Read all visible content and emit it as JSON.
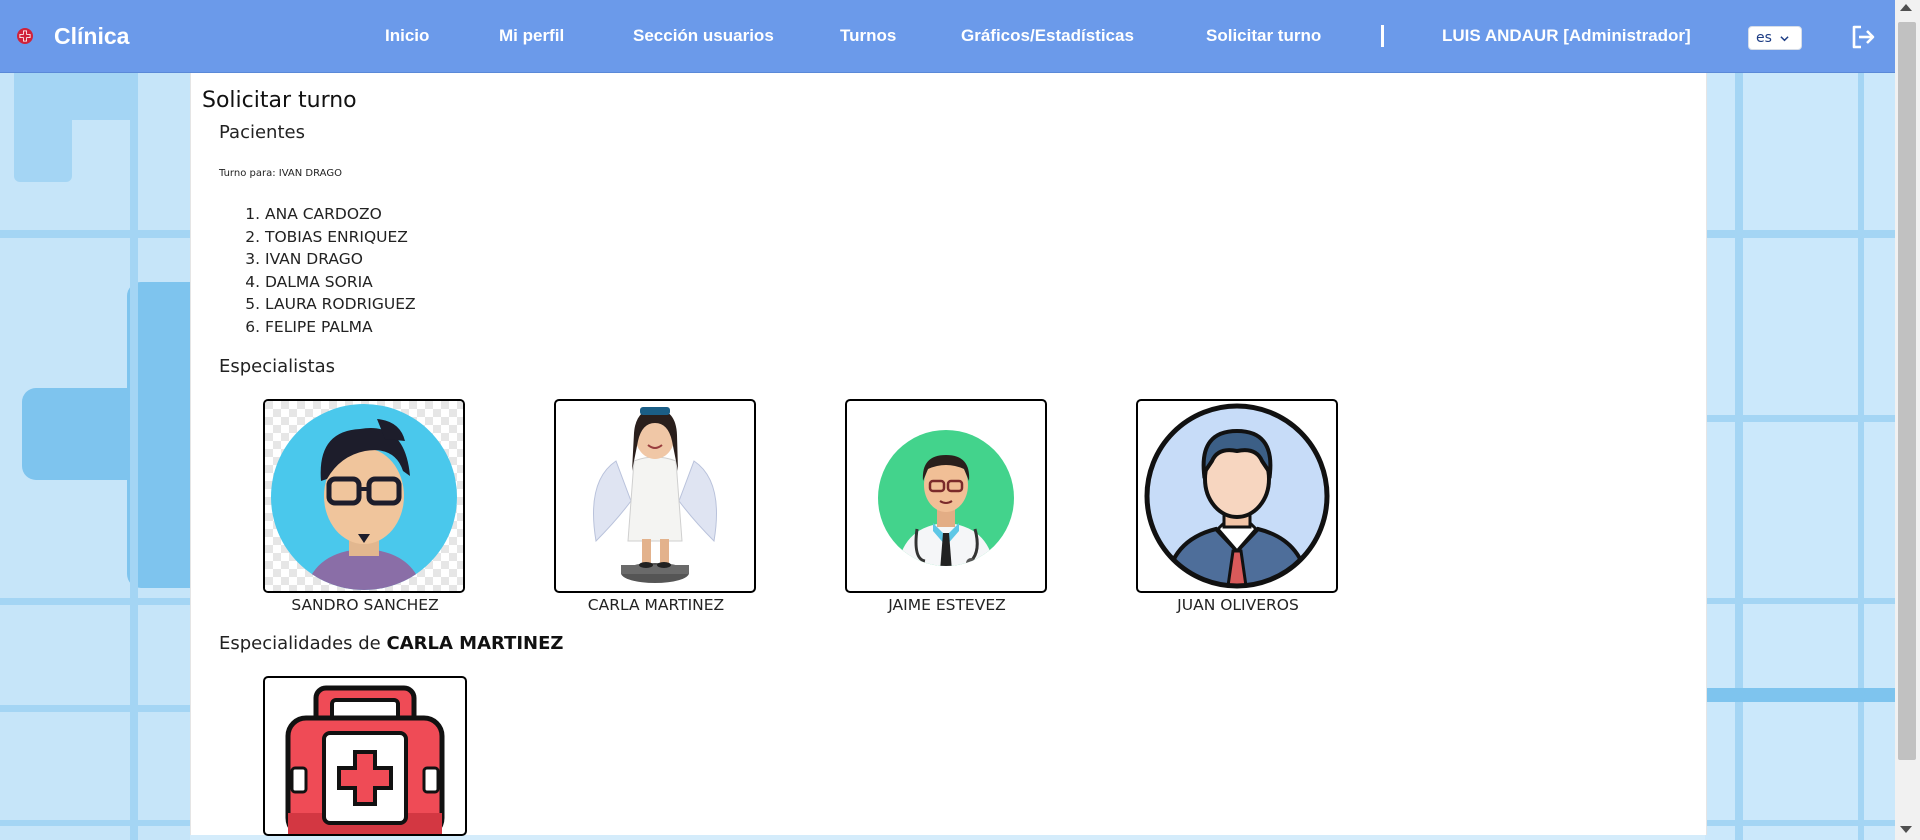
{
  "app": {
    "name": "Clínica"
  },
  "nav": {
    "items": [
      "Inicio",
      "Mi perfil",
      "Sección usuarios",
      "Turnos",
      "Gráficos/Estadísticas",
      "Solicitar turno"
    ],
    "user": "LUIS ANDAUR [Administrador]",
    "language": "es",
    "language_icon": "chevron-down-icon",
    "logout_icon": "logout-icon"
  },
  "page": {
    "title": "Solicitar turno",
    "patients_heading": "Pacientes",
    "turno_para": "Turno para: IVAN DRAGO",
    "patients": [
      "ANA CARDOZO",
      "TOBIAS ENRIQUEZ",
      "IVAN DRAGO",
      "DALMA SORIA",
      "LAURA RODRIGUEZ",
      "FELIPE PALMA"
    ],
    "specialists_heading": "Especialistas",
    "specialists": [
      "SANDRO SANCHEZ",
      "CARLA MARTINEZ",
      "JAIME ESTEVEZ",
      "JUAN OLIVEROS"
    ],
    "specialties_prefix": "Especialidades de",
    "specialties_of": "CARLA MARTINEZ",
    "specialty_icon": "first-aid-kit-icon"
  },
  "colors": {
    "navbar": "#6b9aea",
    "brand_icon": "#d0223a",
    "background": "#d4ecfb"
  }
}
